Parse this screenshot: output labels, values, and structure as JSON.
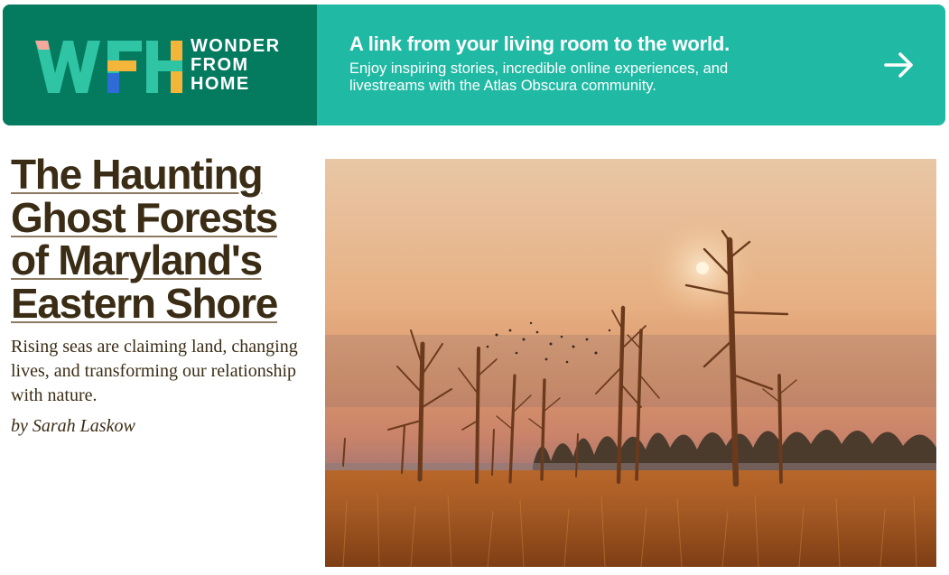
{
  "banner": {
    "logo_letters": "WFH",
    "logo_words": [
      "WONDER",
      "FROM",
      "HOME"
    ],
    "headline": "A link from your living room to the world.",
    "subtext": "Enjoy inspiring stories, incredible online experiences, and livestreams with the Atlas Obscura community.",
    "arrow_icon": "arrow-right-icon",
    "colors": {
      "left": "#047a5f",
      "right": "#20b9a3"
    }
  },
  "article": {
    "title": "The Haunting Ghost Forests of Maryland's Eastern Shore",
    "dek": "Rising seas are claiming land, changing lives, and transforming our relationship with nature.",
    "byline": "by Sarah Laskow"
  },
  "colors": {
    "text": "#3b2d15"
  }
}
